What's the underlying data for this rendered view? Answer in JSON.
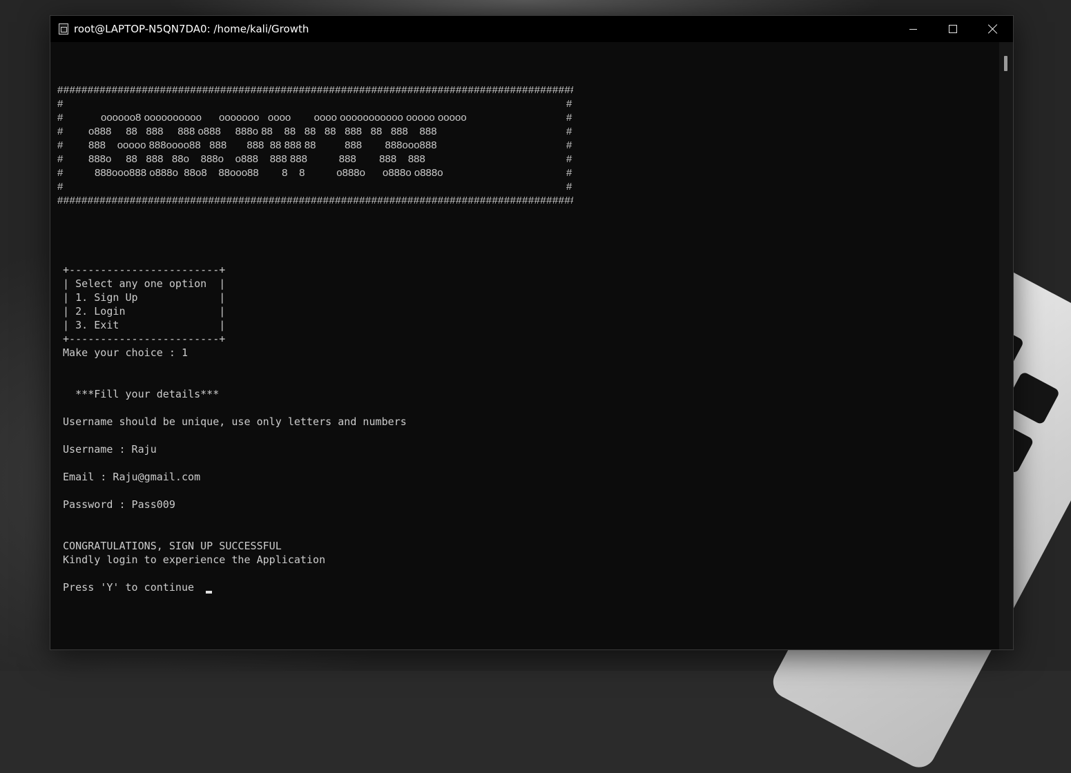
{
  "window": {
    "title": "root@LAPTOP-N5QN7DA0: /home/kali/Growth"
  },
  "banner": {
    "hash_row": "########################################################################################",
    "edge": "#",
    "rows": [
      "oooooo8 oooooooooo      ooooooo   oooo        oooo ooooooooooo ooooo ooooo",
      "o888     88   888     888 o888     888o 88    88   88   88   888   88   888    888",
      "888    ooooo 888oooo88   888       888  88 888 88          888        888ooo888",
      "888o     88   888   88o    888o    o888    888 888           888        888    888",
      "888ooo888 o888o  88o8    88ooo88        8    8           o888o      o888o o888o"
    ]
  },
  "menu": {
    "border": "+------------------------+",
    "title": "| Select any one option  |",
    "items": [
      "| 1. Sign Up             |",
      "| 2. Login               |",
      "| 3. Exit                |"
    ],
    "prompt": "Make your choice : 1"
  },
  "form": {
    "heading": "  ***Fill your details***",
    "hint": "Username should be unique, use only letters and numbers",
    "username_line": "Username : Raju",
    "email_line": "Email : Raju@gmail.com",
    "password_line": "Password : Pass009"
  },
  "result": {
    "success": "CONGRATULATIONS, SIGN UP SUCCESSFUL",
    "info": "Kindly login to experience the Application",
    "continue_prompt": "Press 'Y' to continue "
  }
}
